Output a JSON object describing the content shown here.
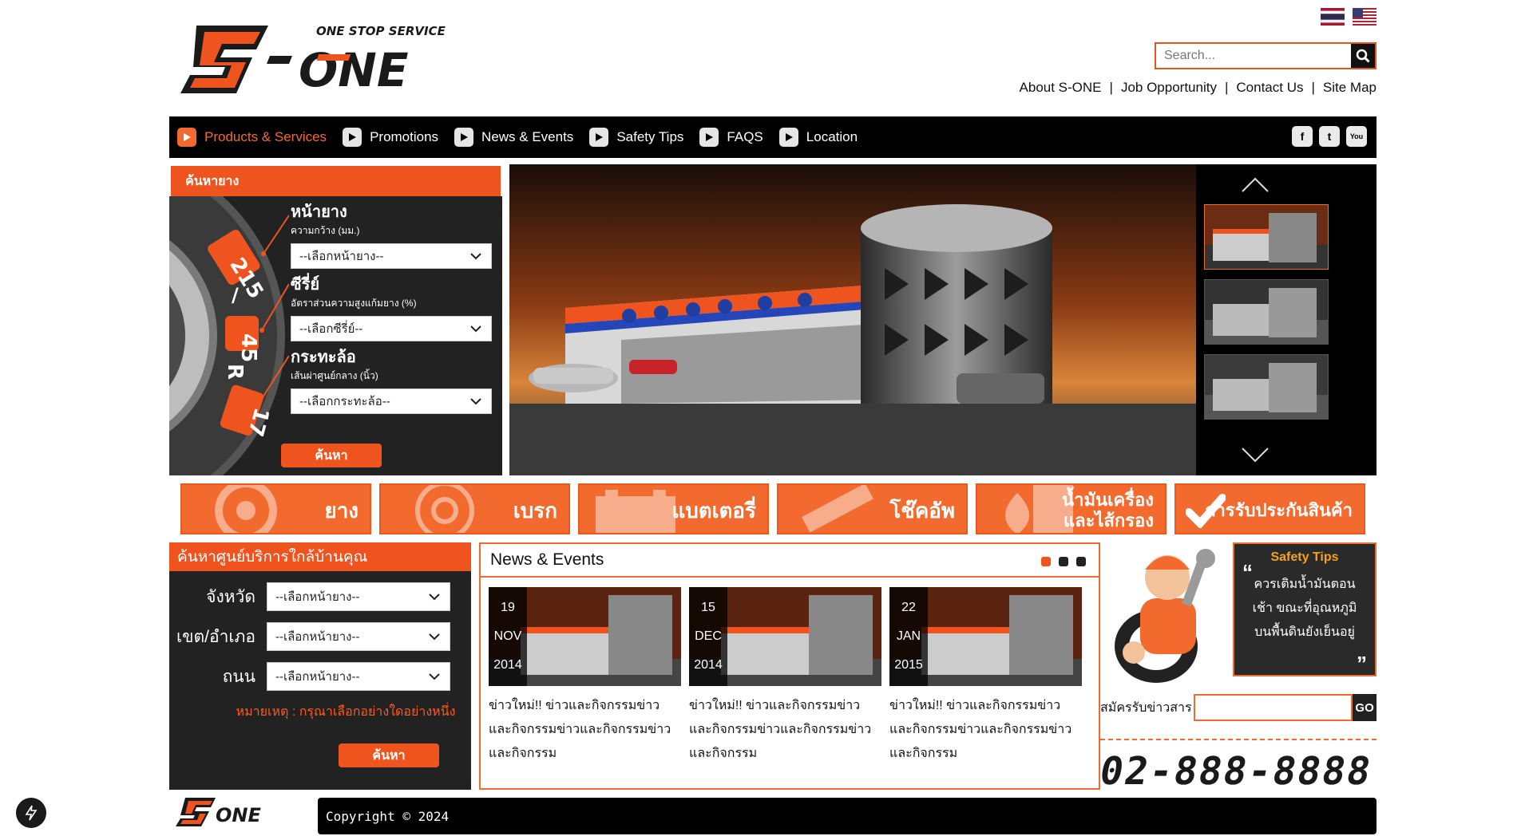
{
  "header": {
    "brand": "S-ONE",
    "tagline": "ONE STOP SERVICE",
    "search_placeholder": "Search...",
    "links": [
      "About S-ONE",
      "Job Opportunity",
      "Contact Us",
      "Site Map"
    ]
  },
  "nav": {
    "items": [
      {
        "label": "Products & Services",
        "active": true
      },
      {
        "label": "Promotions"
      },
      {
        "label": "News & Events"
      },
      {
        "label": "Safety Tips"
      },
      {
        "label": "FAQS"
      },
      {
        "label": "Location"
      }
    ],
    "social": [
      "facebook-icon",
      "twitter-icon",
      "youtube-icon"
    ]
  },
  "tire_search": {
    "title": "ค้นหายาง",
    "tire_marking": [
      "215",
      "45",
      "R",
      "17"
    ],
    "fields": [
      {
        "title": "หน้ายาง",
        "sub": "ความกว้าง (มม.)",
        "select": "--เลือกหน้ายาง--"
      },
      {
        "title": "ซีรี่ย์",
        "sub": "อัตราส่วนความสูงแก้มยาง (%)",
        "select": "--เลือกซีรี่ย์--"
      },
      {
        "title": "กระทะล้อ",
        "sub": "เส้นผ่าศูนย์กลาง (นิ้ว)",
        "select": "--เลือกกระทะล้อ--"
      }
    ],
    "button": "ค้นหา"
  },
  "categories": [
    "ยาง",
    "เบรก",
    "แบตเตอรี่",
    "โช๊คอัพ",
    "น้ำมันเครื่อง\nและไส้กรอง",
    "การรับประกันสินค้า"
  ],
  "service_search": {
    "title": "ค้นหาศูนย์บริการใกล้บ้านคุณ",
    "rows": [
      {
        "label": "จังหวัด",
        "select": "--เลือกหน้ายาง--"
      },
      {
        "label": "เขต/อำเภอ",
        "select": "--เลือกหน้ายาง--"
      },
      {
        "label": "ถนน",
        "select": "--เลือกหน้ายาง--"
      }
    ],
    "note": "หมายเหตุ : กรุณาเลือกอย่างใดอย่างหนึ่ง",
    "button": "ค้นหา"
  },
  "news": {
    "title": "News & Events",
    "items": [
      {
        "day": "19",
        "month": "NOV",
        "year": "2014",
        "text": "ข่าวใหม่!! ข่าวและกิจกรรมข่าว และกิจกรรมข่าวและกิจกรรมข่าว และกิจกรรม"
      },
      {
        "day": "15",
        "month": "DEC",
        "year": "2014",
        "text": "ข่าวใหม่!! ข่าวและกิจกรรมข่าว และกิจกรรมข่าวและกิจกรรมข่าว และกิจกรรม"
      },
      {
        "day": "22",
        "month": "JAN",
        "year": "2015",
        "text": "ข่าวใหม่!! ข่าวและกิจกรรมข่าว และกิจกรรมข่าวและกิจกรรมข่าว และกิจกรรม"
      }
    ]
  },
  "safety_tips": {
    "title": "Safety Tips",
    "text": "ควรเติมน้ำมันตอนเช้า ขณะที่อุณหภูมิบนพื้นดินยังเย็นอยู่"
  },
  "subscribe": {
    "label": "สมัครรับข่าวสาร",
    "button": "GO"
  },
  "phone": "02-888-8888",
  "footer": {
    "copyright": "Copyright © 2024"
  },
  "colors": {
    "accent": "#f26a2e",
    "dark": "#222222",
    "black": "#000000"
  }
}
